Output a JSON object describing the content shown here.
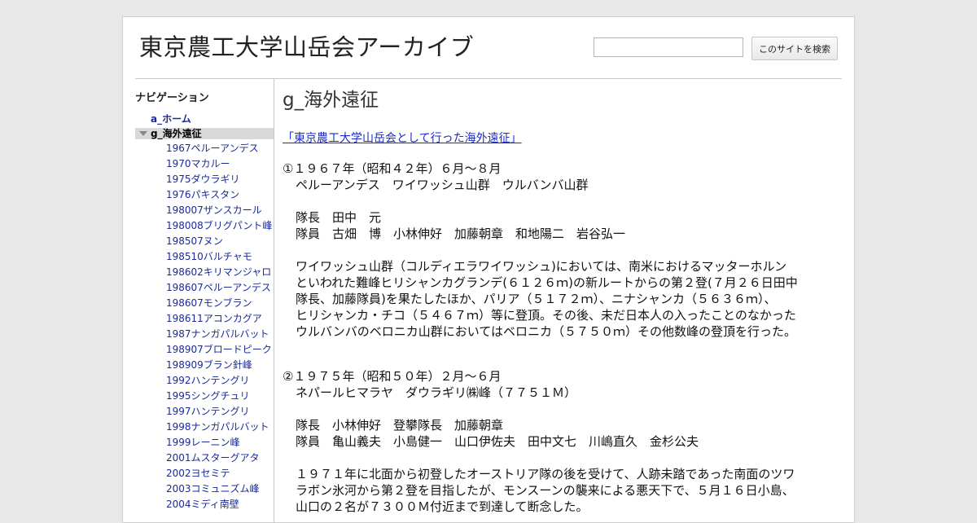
{
  "header": {
    "site_title": "東京農工大学山岳会アーカイブ",
    "search": {
      "button_label": "このサイトを検索",
      "value": ""
    }
  },
  "sidebar": {
    "heading": "ナビゲーション",
    "home": "a_ホーム",
    "current": "g_海外遠征",
    "items": [
      "1967ペルーアンデス",
      "1970マカルー",
      "1975ダウラギリ",
      "1976パキスタン",
      "198007ザンスカール",
      "198008ブリグパント峰",
      "198507ヌン",
      "198510バルチャモ",
      "198602キリマンジャロ",
      "198607ペルーアンデス",
      "198607モンブラン",
      "198611アコンカグア",
      "1987ナンガパルバット",
      "198907ブロードピーク",
      "198909ブラン針峰",
      "1992ハンテングリ",
      "1995シングチュリ",
      "1997ハンテングリ",
      "1998ナンガパルバット",
      "1999レーニン峰",
      "2001ムスターグアタ",
      "2002ヨセミテ",
      "2003コミュニズム峰",
      "2004ミディ南壁"
    ]
  },
  "main": {
    "heading": "g_海外遠征",
    "intro_link": "「東京農工大学山岳会として行った海外遠征」",
    "expeditions": [
      {
        "title": "①１９６７年（昭和４２年）６月〜８月",
        "region": "ペルーアンデス　ワイワッシュ山群　ウルバンバ山群",
        "leader": "隊長　田中　元",
        "members": "隊員　古畑　博　小林伸好　加藤朝章　和地陽二　岩谷弘一",
        "description": [
          "ワイワッシュ山群（コルディエラワイワッシュ)においては、南米におけるマッターホルン",
          "といわれた難峰ヒリシャンカグランデ(６１２６ｍ)の新ルートからの第２登(７月２６日田中",
          "隊長、加藤隊員)を果たしたほか、パリア（５１７２ｍ）、ニナシャンカ（５６３６ｍ）、",
          "ヒリシャンカ・チコ（５４６７ｍ）等に登頂。その後、未だ日本人の入ったことのなかった",
          "ウルバンバのベロニカ山群においてはベロニカ（５７５０ｍ）その他数峰の登頂を行った。"
        ]
      },
      {
        "title": "②１９７５年（昭和５０年）２月〜６月",
        "region": "ネパールヒマラヤ　ダウラギリ㈱峰（７７５１Ｍ）",
        "leader": "隊長　小林伸好　登攀隊長　加藤朝章",
        "members": "隊員　亀山義夫　小島健一　山口伊佐夫　田中文七　川嶋直久　金杉公夫",
        "description": [
          "１９７１年に北面から初登したオーストリア隊の後を受けて、人跡未踏であった南面のツワ",
          "ラボン氷河から第２登を目指したが、モンスーンの襲来による悪天下で、５月１６日小島、",
          "山口の２名が７３００Ｍ付近まで到達して断念した。"
        ]
      }
    ]
  }
}
